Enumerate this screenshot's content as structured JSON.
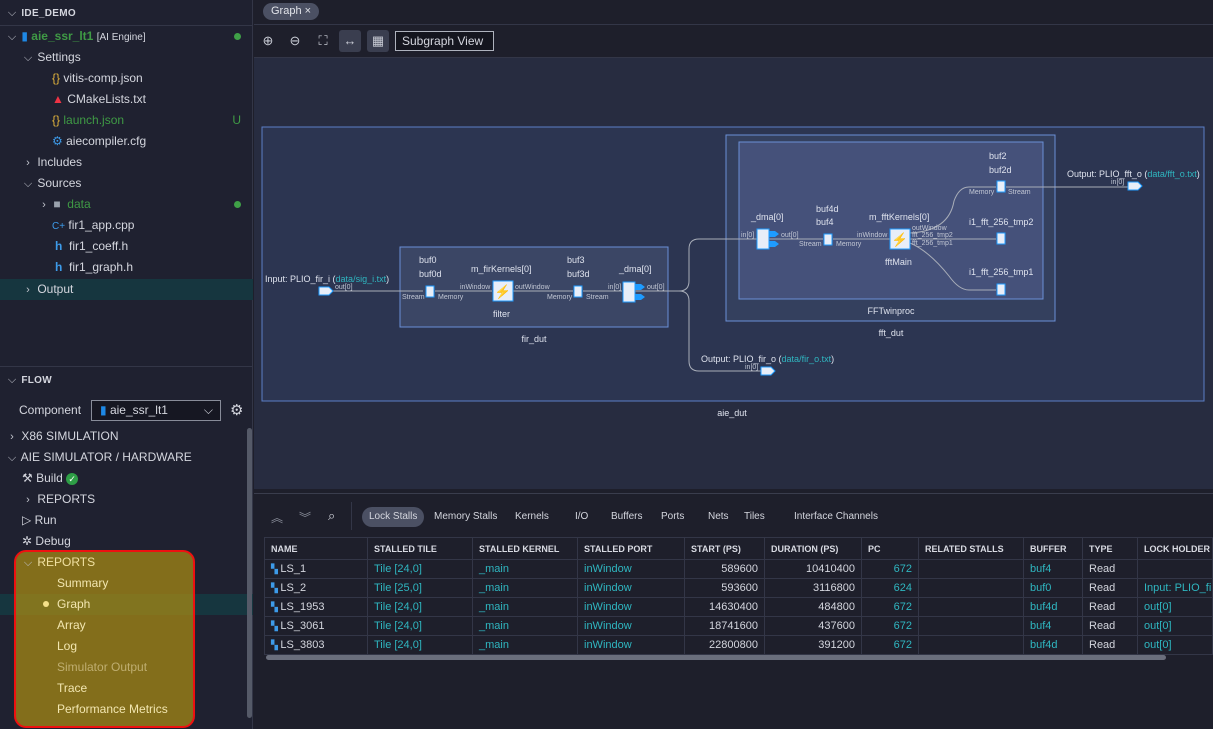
{
  "explorer": {
    "title": "IDE_DEMO",
    "project": {
      "name": "aie_ssr_lt1",
      "tag": "[AI Engine]"
    },
    "items": [
      {
        "label": "Settings"
      },
      {
        "label": "vitis-comp.json",
        "icon": "json-braces-icon"
      },
      {
        "label": "CMakeLists.txt",
        "icon": "cmake-icon"
      },
      {
        "label": "launch.json",
        "icon": "json-braces-icon",
        "status": "U"
      },
      {
        "label": "aiecompiler.cfg",
        "icon": "gear-icon"
      },
      {
        "label": "Includes"
      },
      {
        "label": "Sources"
      },
      {
        "label": "data",
        "icon": "folder-icon"
      },
      {
        "label": "fir1_app.cpp",
        "icon": "cpp-icon"
      },
      {
        "label": "fir1_coeff.h",
        "icon": "h-icon"
      },
      {
        "label": "fir1_graph.h",
        "icon": "h-icon"
      },
      {
        "label": "Output"
      }
    ]
  },
  "flow": {
    "title": "FLOW",
    "component_label": "Component",
    "component_value": "aie_ssr_lt1",
    "items": [
      {
        "label": "X86 SIMULATION"
      },
      {
        "label": "AIE SIMULATOR / HARDWARE"
      },
      {
        "label": "Build"
      },
      {
        "label": "REPORTS"
      },
      {
        "label": "Run"
      },
      {
        "label": "Debug"
      },
      {
        "label": "REPORTS"
      },
      {
        "label": "Summary"
      },
      {
        "label": "Graph"
      },
      {
        "label": "Array"
      },
      {
        "label": "Log"
      },
      {
        "label": "Simulator Output"
      },
      {
        "label": "Trace"
      },
      {
        "label": "Performance Metrics"
      }
    ]
  },
  "editor": {
    "tab": "Graph",
    "view_select": "Subgraph View"
  },
  "graph": {
    "aie_dut": "aie_dut",
    "fir_dut": "fir_dut",
    "fft_dut": "fft_dut",
    "fftwinproc": "FFTwinproc",
    "input_plio": "Input: PLIO_fir_i (",
    "input_file": "data/sig_i.txt",
    "out_fft_plio": "Output: PLIO_fft_o (",
    "out_fft_file": "data/fft_o.txt",
    "out_fir_plio": "Output: PLIO_fir_o (",
    "out_fir_file": "data/fir_o.txt",
    "close_paren": ")",
    "buf0": "buf0",
    "buf0d": "buf0d",
    "fir_kernel": "m_firKernels[0]",
    "filter": "filter",
    "buf3": "buf3",
    "buf3d": "buf3d",
    "dma": "_dma[0]",
    "buf4d": "buf4d",
    "buf4": "buf4",
    "fft_kernel": "m_fftKernels[0]",
    "fftmain": "fftMain",
    "buf2": "buf2",
    "buf2d": "buf2d",
    "tmp2": "i1_fft_256_tmp2",
    "tmp1": "i1_fft_256_tmp1",
    "ports": {
      "out0": "out[0]",
      "in0": "in[0]",
      "stream": "Stream",
      "memory": "Memory",
      "inwindow": "inWindow",
      "outwindow": "outWindow",
      "p_tmp2": "fft_256_tmp2",
      "p_tmp1": "fft_256_tmp1"
    }
  },
  "report": {
    "tabs": [
      "Lock Stalls",
      "Memory Stalls",
      "Kernels",
      "I/O",
      "Buffers",
      "Ports",
      "Nets",
      "Tiles",
      "Interface Channels"
    ],
    "active_tab": "Lock Stalls",
    "columns": [
      "NAME",
      "STALLED TILE",
      "STALLED KERNEL",
      "STALLED PORT",
      "START (PS)",
      "DURATION (PS)",
      "PC",
      "RELATED STALLS",
      "BUFFER",
      "TYPE",
      "LOCK HOLDER"
    ],
    "rows": [
      [
        "LS_1",
        "Tile [24,0]",
        "_main",
        "inWindow",
        "589600",
        "10410400",
        "672",
        "",
        "buf4",
        "Read",
        ""
      ],
      [
        "LS_2",
        "Tile [25,0]",
        "_main",
        "inWindow",
        "593600",
        "3116800",
        "624",
        "",
        "buf0",
        "Read",
        "Input: PLIO_fir_i"
      ],
      [
        "LS_1953",
        "Tile [24,0]",
        "_main",
        "inWindow",
        "14630400",
        "484800",
        "672",
        "",
        "buf4d",
        "Read",
        "out[0]"
      ],
      [
        "LS_3061",
        "Tile [24,0]",
        "_main",
        "inWindow",
        "18741600",
        "437600",
        "672",
        "",
        "buf4",
        "Read",
        "out[0]"
      ],
      [
        "LS_3803",
        "Tile [24,0]",
        "_main",
        "inWindow",
        "22800800",
        "391200",
        "672",
        "",
        "buf4d",
        "Read",
        "out[0]"
      ]
    ]
  },
  "colors": {
    "accent": "#2fb6c0",
    "highlight_border": "#ee1111",
    "highlight_fill": "#aa8c14",
    "success": "#3fa047"
  }
}
